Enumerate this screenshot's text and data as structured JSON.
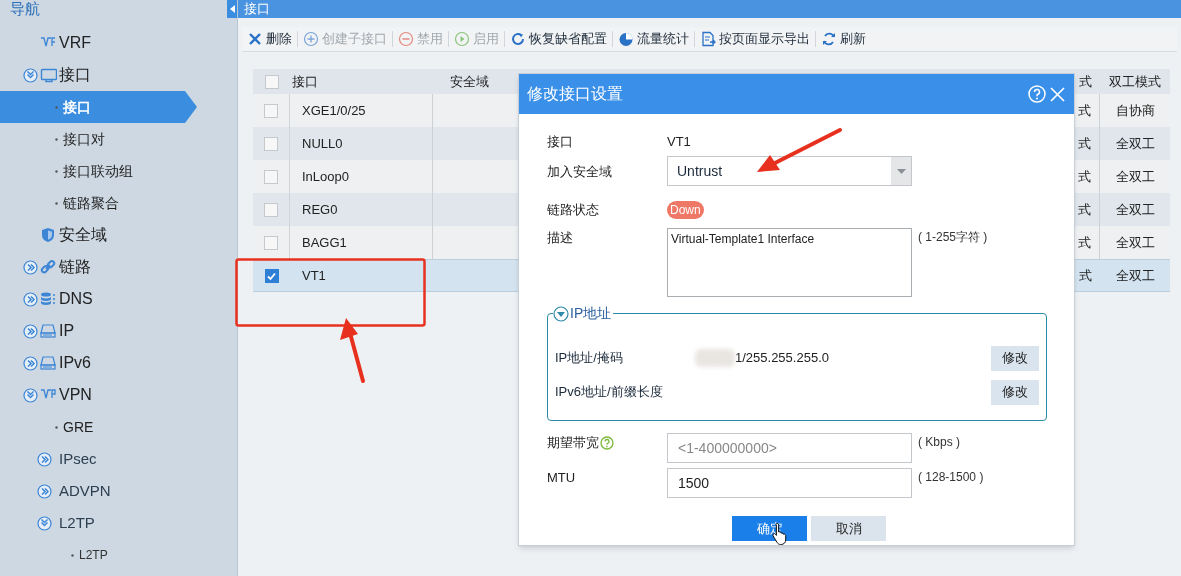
{
  "sidebar": {
    "title": "导航",
    "items": [
      {
        "label": "VRF",
        "selected": false
      },
      {
        "label": "接口",
        "selected": false,
        "expanded": true,
        "children": [
          {
            "label": "接口",
            "selected": true
          },
          {
            "label": "接口对",
            "selected": false
          },
          {
            "label": "接口联动组",
            "selected": false
          },
          {
            "label": "链路聚合",
            "selected": false
          }
        ]
      },
      {
        "label": "安全域",
        "selected": false
      },
      {
        "label": "链路",
        "selected": false,
        "expanded": false
      },
      {
        "label": "DNS",
        "selected": false,
        "expanded": false
      },
      {
        "label": "IP",
        "selected": false,
        "expanded": false
      },
      {
        "label": "IPv6",
        "selected": false,
        "expanded": false
      },
      {
        "label": "VPN",
        "selected": false,
        "expanded": true,
        "children": [
          {
            "label": "GRE",
            "selected": false
          },
          {
            "label": "IPsec",
            "selected": false,
            "expanded": false
          },
          {
            "label": "ADVPN",
            "selected": false,
            "expanded": false
          },
          {
            "label": "L2TP",
            "selected": false,
            "expanded": true,
            "children": [
              {
                "label": "L2TP",
                "selected": false
              }
            ]
          }
        ]
      }
    ]
  },
  "page_title": "接口",
  "toolbar": [
    {
      "label": "删除",
      "disabled": false
    },
    {
      "label": "创建子接口",
      "disabled": true
    },
    {
      "label": "禁用",
      "disabled": true
    },
    {
      "label": "启用",
      "disabled": true
    },
    {
      "label": "恢复缺省配置",
      "disabled": false
    },
    {
      "label": "流量统计",
      "disabled": false
    },
    {
      "label": "按页面显示导出",
      "disabled": false
    },
    {
      "label": "刷新",
      "disabled": false
    }
  ],
  "table": {
    "select_all_checked": false,
    "columns": [
      "接口",
      "安全域",
      "式",
      "双工模式"
    ],
    "rows": [
      {
        "checked": false,
        "selected": false,
        "cells": [
          "XGE1/0/25",
          "",
          "式",
          "自协商"
        ]
      },
      {
        "checked": false,
        "selected": false,
        "cells": [
          "NULL0",
          "",
          "式",
          "全双工"
        ]
      },
      {
        "checked": false,
        "selected": false,
        "cells": [
          "InLoop0",
          "",
          "式",
          "全双工"
        ]
      },
      {
        "checked": false,
        "selected": false,
        "cells": [
          "REG0",
          "",
          "式",
          "全双工"
        ]
      },
      {
        "checked": false,
        "selected": false,
        "cells": [
          "BAGG1",
          "",
          "式",
          "全双工"
        ]
      },
      {
        "checked": true,
        "selected": true,
        "cells": [
          "VT1",
          "",
          "式",
          "全双工"
        ]
      }
    ]
  },
  "dialog": {
    "title": "修改接口设置",
    "fields": [
      {
        "kind": "text",
        "label": "接口",
        "value": "VT1"
      },
      {
        "kind": "select",
        "label": "加入安全域",
        "value": "Untrust"
      },
      {
        "kind": "badge",
        "label": "链路状态",
        "value": "Down",
        "color": "#ee7766"
      },
      {
        "kind": "textarea",
        "label": "描述",
        "value": "Virtual-Template1 Interface",
        "hint": "( 1-255字符 )"
      }
    ],
    "ip_group": {
      "legend": "IP地址",
      "expanded": true,
      "rows": [
        {
          "label": "IP地址/掩码",
          "value": "1/255.255.255.0",
          "button": "修改"
        },
        {
          "label": "IPv6地址/前缀长度",
          "button": "修改"
        }
      ]
    },
    "more_fields": [
      {
        "kind": "input",
        "label": "期望带宽",
        "help": true,
        "placeholder": "<1-400000000>",
        "hint": "( Kbps )"
      },
      {
        "kind": "input",
        "label": "MTU",
        "help": false,
        "value": "1500",
        "hint": "( 128-1500 )"
      }
    ],
    "buttons": [
      {
        "label": "确定",
        "primary": true
      },
      {
        "label": "取消",
        "primary": false
      }
    ]
  }
}
